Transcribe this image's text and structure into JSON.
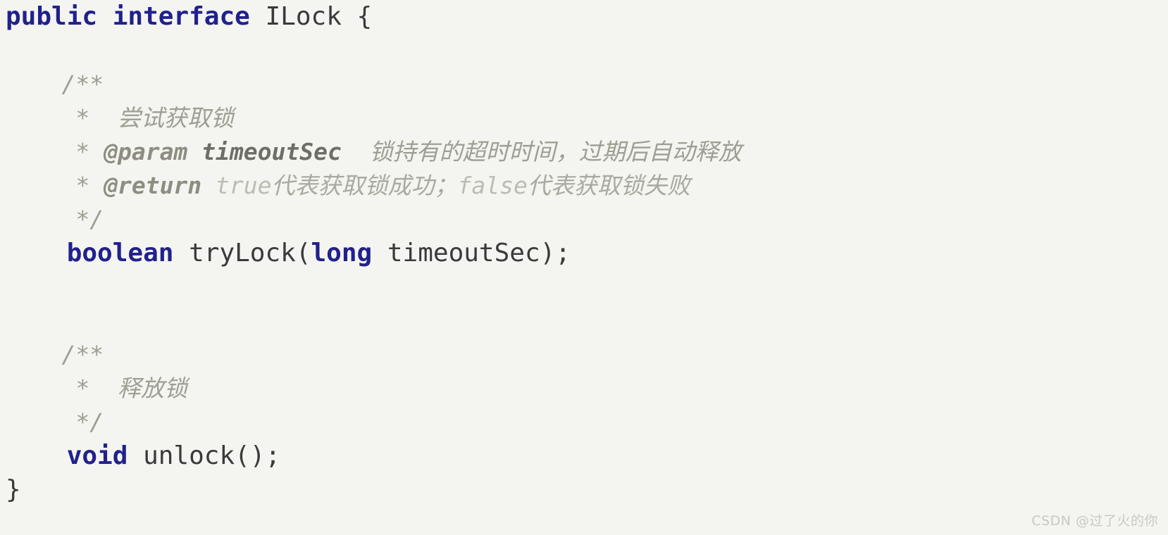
{
  "theme": {
    "background": "#f4f5f0",
    "keyword_color": "#21218c",
    "identifier_color": "#3a3a3a",
    "comment_color": "#9e9e93",
    "comment_literal_color": "#bcbcb2",
    "watermark_color": "#c9c9c2"
  },
  "code": {
    "language": "java",
    "declaration": {
      "modifier": "public",
      "type_keyword": "interface",
      "name_and_brace": "ILock {"
    },
    "javadoc_1": {
      "open": "/**",
      "star": "*",
      "summary_cjk": "尝试获取锁",
      "param_tag": "@param",
      "param_name": "timeoutSec",
      "param_desc_cjk": "锁持有的超时时间，过期后自动释放",
      "return_tag": "@return",
      "return_true_literal": "true",
      "return_true_cjk": "代表获取锁成功；",
      "return_false_literal": "false",
      "return_false_cjk": "代表获取锁失败",
      "close": "*/"
    },
    "method_1": {
      "return_type": "boolean",
      "name_open": " tryLock(",
      "param_type": "long",
      "param_tail": " timeoutSec);"
    },
    "javadoc_2": {
      "open": "/**",
      "star": "*",
      "summary_cjk": "释放锁",
      "close": "*/"
    },
    "method_2": {
      "return_type": "void",
      "name_tail": " unlock();"
    },
    "closing_brace": "}"
  },
  "watermark": {
    "text": "CSDN @过了火的你"
  }
}
